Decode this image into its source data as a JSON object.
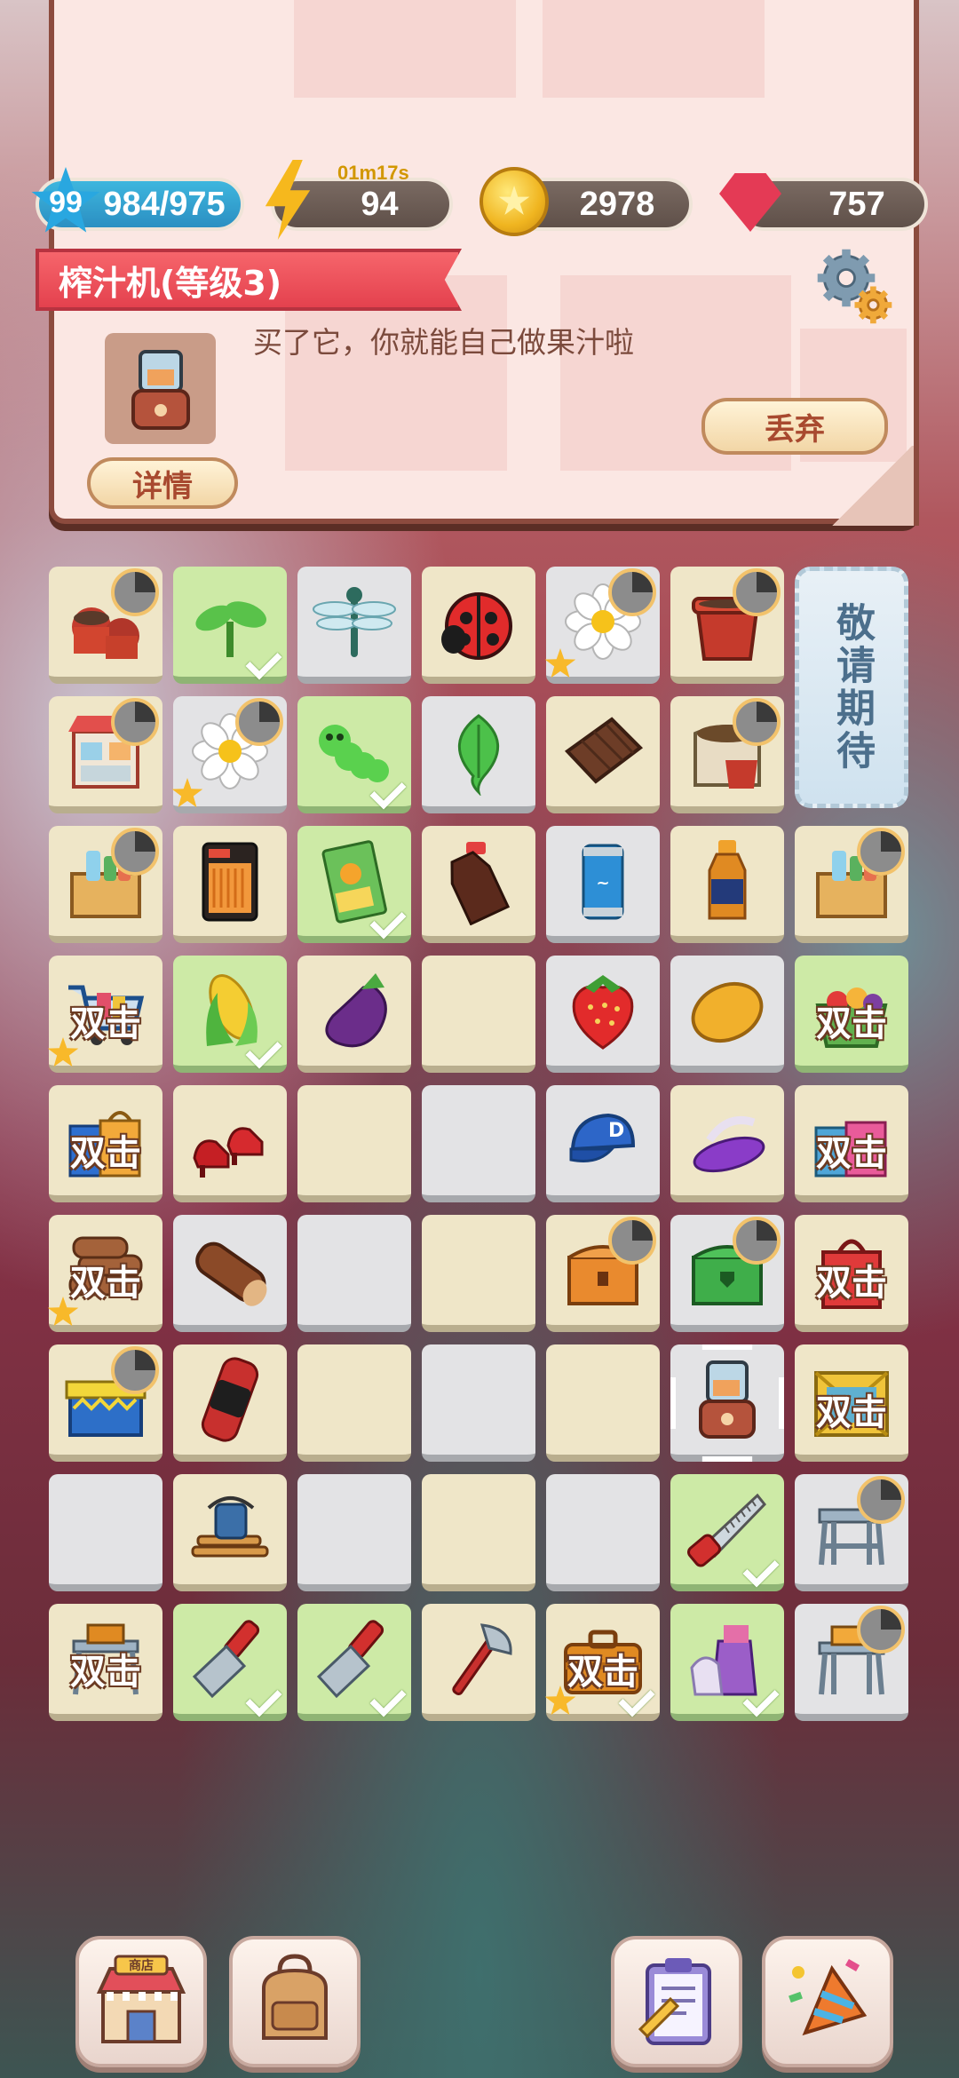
{
  "status": {
    "level": "99",
    "xp": "984/975",
    "energy_timer": "01m17s",
    "energy": "94",
    "coins": "2978",
    "gems": "757"
  },
  "item_panel": {
    "title": "榨汁机(等级3)",
    "description": "买了它，你就能自己做果汁啦",
    "detail_button": "详情",
    "discard_button": "丢弃"
  },
  "board": {
    "coming_soon": "敬请期待",
    "double_click_label": "双击",
    "cells": [
      [
        "flower-pots-stack",
        "sprout",
        "dragonfly",
        "ladybug",
        "daisy-flower",
        "clay-pot",
        "coming-soon"
      ],
      [
        "vending-machine",
        "daisy-flower",
        "green-caterpillar",
        "green-leaf",
        "chocolate-bar",
        "seed-sack-pot",
        "coming-soon"
      ],
      [
        "drink-crate",
        "snack-bag-orange",
        "seed-packet",
        "cola-bottle",
        "soda-can",
        "juice-bottle",
        "drink-crate"
      ],
      [
        "shopping-cart",
        "corn",
        "eggplant",
        "empty",
        "strawberry",
        "mango",
        "fruit-basket"
      ],
      [
        "shopping-bags",
        "red-heels",
        "empty",
        "empty",
        "blue-cap",
        "purple-sandals",
        "shopping-bags-pink"
      ],
      [
        "log-pile",
        "log",
        "empty",
        "empty",
        "orange-chest",
        "green-chest",
        "red-shopping-bag"
      ],
      [
        "blue-gift-box",
        "red-watch",
        "empty",
        "empty",
        "empty",
        "juicer",
        "golden-crate"
      ],
      [
        "empty",
        "firewood-kettle",
        "empty",
        "empty",
        "empty",
        "hand-saw",
        "metal-stool"
      ],
      [
        "tool-stand",
        "scraper",
        "scraper",
        "axe",
        "tool-case",
        "cleaning-supplies",
        "tool-stool"
      ]
    ]
  },
  "bottom_nav": [
    "shop-icon",
    "backpack-icon",
    "task-list-icon",
    "party-icon"
  ],
  "bottom_nav_labels": {
    "shop_sign": "商店"
  }
}
